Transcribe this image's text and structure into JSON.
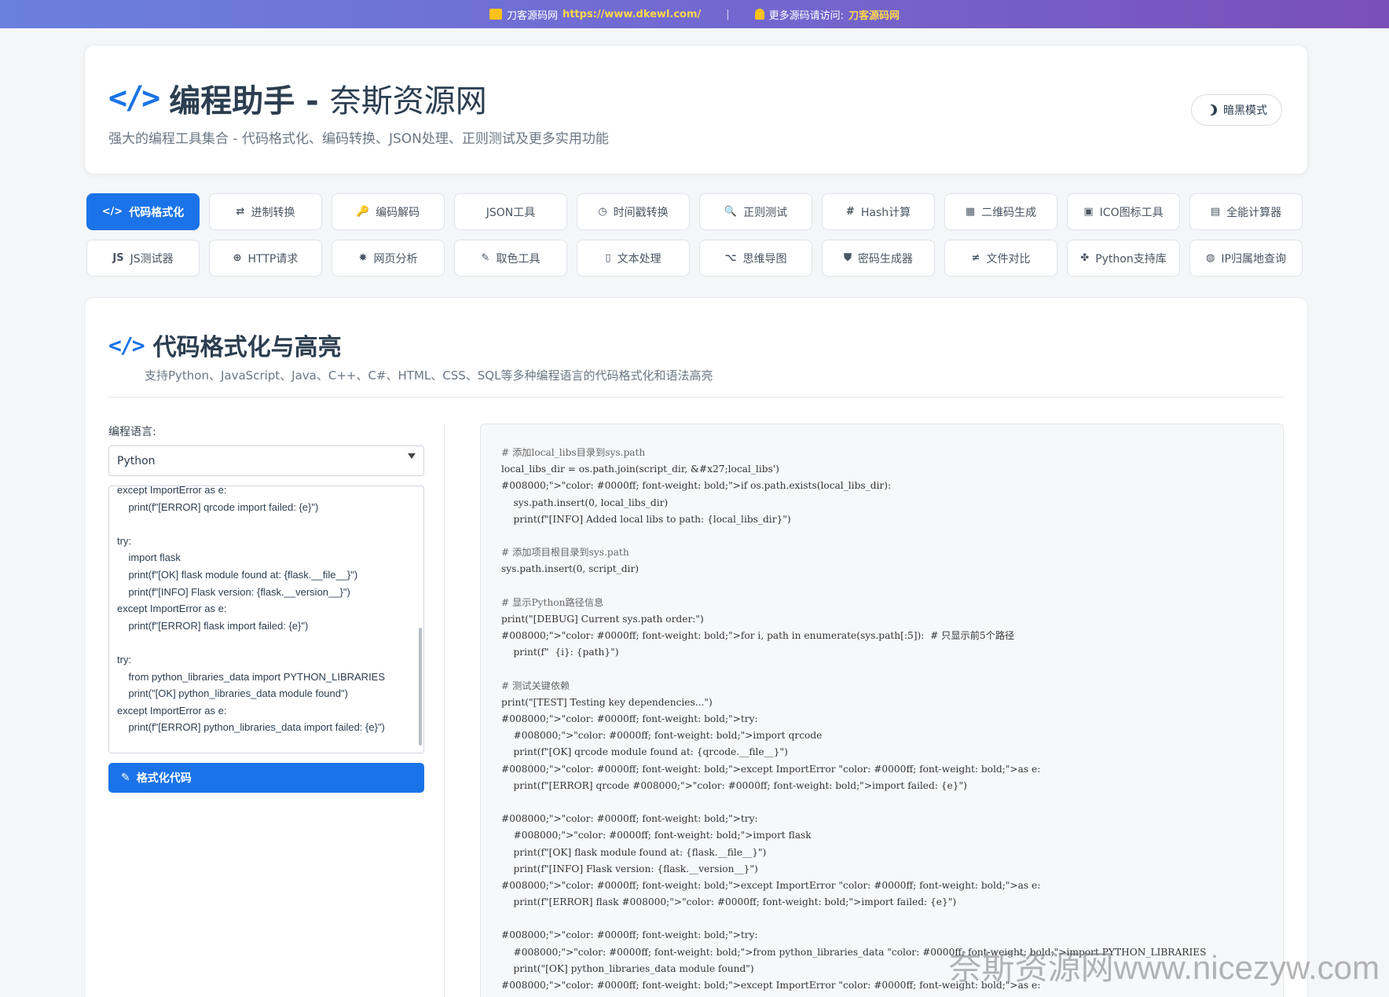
{
  "banner": {
    "site_name": "刀客源码网",
    "url": "https://www.dkewl.com/",
    "separator": "|",
    "more_text": "更多源码请访问:",
    "more_link": "刀客源码网"
  },
  "header": {
    "icon": "</>",
    "title": "编程助手 -",
    "title_suffix": "奈斯资源网",
    "subtitle": "强大的编程工具集合 - 代码格式化、编码转换、JSON处理、正则测试及更多实用功能",
    "dark_mode_label": "暗黑模式"
  },
  "tabs_row1": [
    {
      "icon": "</>",
      "label": "代码格式化"
    },
    {
      "icon": "⇄",
      "label": "进制转换"
    },
    {
      "icon": "🔑",
      "label": "编码解码"
    },
    {
      "icon": "",
      "label": "JSON工具"
    },
    {
      "icon": "◷",
      "label": "时间戳转换"
    },
    {
      "icon": "🔍",
      "label": "正则测试"
    },
    {
      "icon": "#",
      "label": "Hash计算"
    },
    {
      "icon": "▦",
      "label": "二维码生成"
    },
    {
      "icon": "▣",
      "label": "ICO图标工具"
    },
    {
      "icon": "▤",
      "label": "全能计算器"
    }
  ],
  "tabs_row2": [
    {
      "icon": "JS",
      "label": "JS测试器"
    },
    {
      "icon": "⊕",
      "label": "HTTP请求"
    },
    {
      "icon": "✸",
      "label": "网页分析"
    },
    {
      "icon": "✎",
      "label": "取色工具"
    },
    {
      "icon": "▯",
      "label": "文本处理"
    },
    {
      "icon": "⌥",
      "label": "思维导图"
    },
    {
      "icon": "⛊",
      "label": "密码生成器"
    },
    {
      "icon": "≠",
      "label": "文件对比"
    },
    {
      "icon": "✤",
      "label": "Python支持库"
    },
    {
      "icon": "◍",
      "label": "IP归属地查询"
    }
  ],
  "section": {
    "icon": "</>",
    "title": "代码格式化与高亮",
    "description": "支持Python、JavaScript、Java、C++、C#、HTML、CSS、SQL等多种编程语言的代码格式化和语法高亮"
  },
  "form": {
    "language_label": "编程语言:",
    "language_value": "Python",
    "format_button": "格式化代码",
    "input_lines": [
      "except ImportError as e:",
      "    print(f\"[ERROR] qrcode import failed: {e}\")",
      "",
      "try:",
      "    import flask",
      "    print(f\"[OK] flask module found at: {flask.__file__}\")",
      "    print(f\"[INFO] Flask version: {flask.__version__}\")",
      "except ImportError as e:",
      "    print(f\"[ERROR] flask import failed: {e}\")",
      "",
      "try:",
      "    from python_libraries_data import PYTHON_LIBRARIES",
      "    print(\"[OK] python_libraries_data module found\")",
      "except ImportError as e:",
      "    print(f\"[ERROR] python_libraries_data import failed: {e}\")"
    ]
  },
  "output_lines": [
    "# 添加local_libs目录到sys.path",
    "local_libs_dir = os.path.join(script_dir, &#x27;local_libs')",
    "#008000;\">\"color: #0000ff; font-weight: bold;\">if os.path.exists(local_libs_dir):",
    "    sys.path.insert(0, local_libs_dir)",
    "    print(f\"[INFO] Added local libs to path: {local_libs_dir}\")",
    "",
    "# 添加项目根目录到sys.path",
    "sys.path.insert(0, script_dir)",
    "",
    "# 显示Python路径信息",
    "print(\"[DEBUG] Current sys.path order:\")",
    "#008000;\">\"color: #0000ff; font-weight: bold;\">for i, path in enumerate(sys.path[:5]):  # 只显示前5个路径",
    "    print(f\"  {i}: {path}\")",
    "",
    "# 测试关键依赖",
    "print(\"[TEST] Testing key dependencies...\")",
    "#008000;\">\"color: #0000ff; font-weight: bold;\">try:",
    "    #008000;\">\"color: #0000ff; font-weight: bold;\">import qrcode",
    "    print(f\"[OK] qrcode module found at: {qrcode.__file__}\")",
    "#008000;\">\"color: #0000ff; font-weight: bold;\">except ImportError \"color: #0000ff; font-weight: bold;\">as e:",
    "    print(f\"[ERROR] qrcode #008000;\">\"color: #0000ff; font-weight: bold;\">import failed: {e}\")",
    "",
    "#008000;\">\"color: #0000ff; font-weight: bold;\">try:",
    "    #008000;\">\"color: #0000ff; font-weight: bold;\">import flask",
    "    print(f\"[OK] flask module found at: {flask.__file__}\")",
    "    print(f\"[INFO] Flask version: {flask.__version__}\")",
    "#008000;\">\"color: #0000ff; font-weight: bold;\">except ImportError \"color: #0000ff; font-weight: bold;\">as e:",
    "    print(f\"[ERROR] flask #008000;\">\"color: #0000ff; font-weight: bold;\">import failed: {e}\")",
    "",
    "#008000;\">\"color: #0000ff; font-weight: bold;\">try:",
    "    #008000;\">\"color: #0000ff; font-weight: bold;\">from python_libraries_data \"color: #0000ff; font-weight: bold;\">import PYTHON_LIBRARIES",
    "    print(\"[OK] python_libraries_data module found\")",
    "#008000;\">\"color: #0000ff; font-weight: bold;\">except ImportError \"color: #0000ff; font-weight: bold;\">as e:"
  ],
  "watermark": "奈斯资源网www.nicezyw.com",
  "colors": {
    "accent": "#1a73e8",
    "banner_start": "#6a80dd",
    "banner_end": "#7a4fb8",
    "link_yellow": "#ffd84a"
  }
}
